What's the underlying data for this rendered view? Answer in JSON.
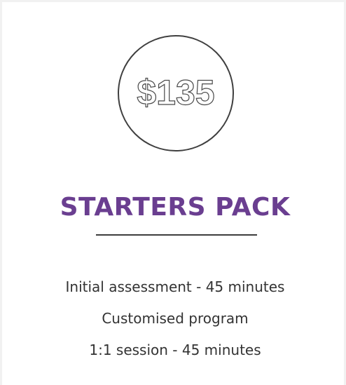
{
  "package": {
    "price": "$135",
    "title": "STARTERS PACK",
    "features": [
      "Initial assessment - 45 minutes",
      "Customised program",
      "1:1 session - 45 minutes"
    ]
  },
  "colors": {
    "title": "#6a3e90",
    "text": "#333333",
    "outline": "#3f3f3f",
    "background": "#f1f1f1",
    "card": "#ffffff"
  }
}
